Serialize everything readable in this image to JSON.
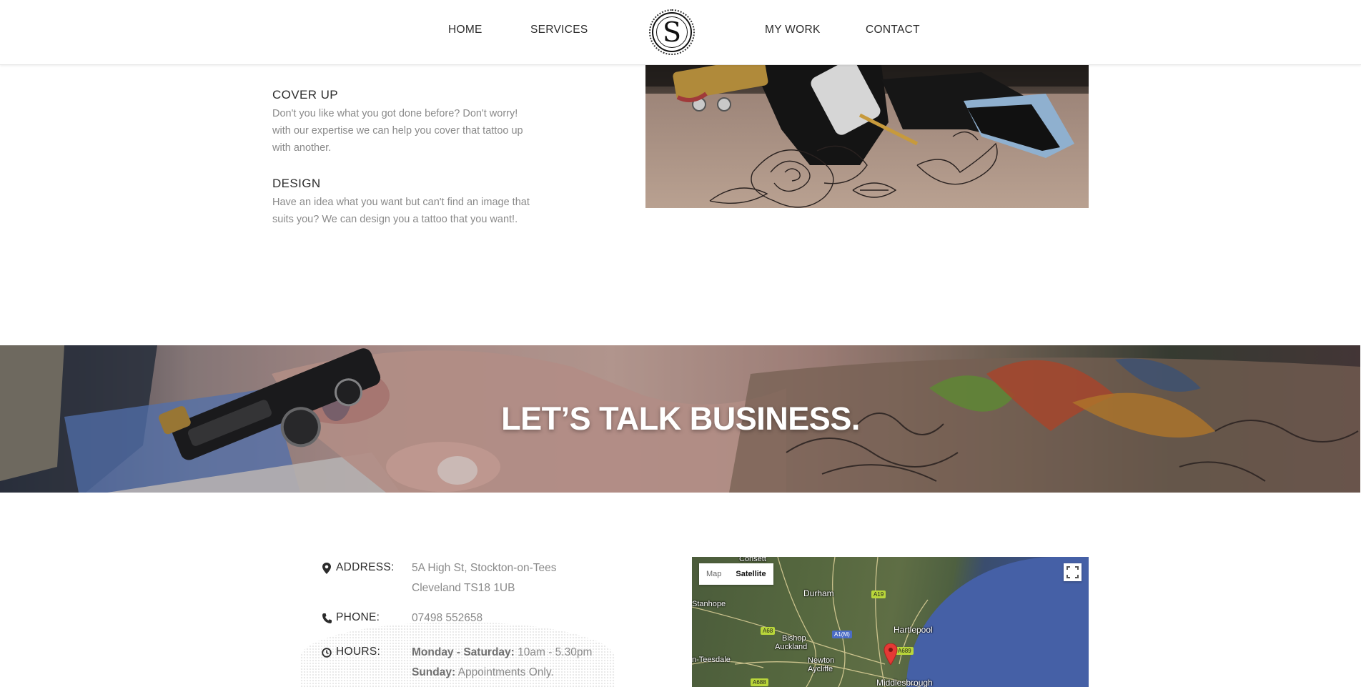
{
  "nav": {
    "home": "HOME",
    "services": "SERVICES",
    "my_work": "MY WORK",
    "contact": "CONTACT",
    "logo_letter": "S"
  },
  "services": [
    {
      "title": "COVER UP",
      "description": "Don't you like what you got done before? Don't worry! with our expertise we can help you cover that tattoo up with another."
    },
    {
      "title": "DESIGN",
      "description": "Have an idea what you want but can't find an image that suits you? We can design you a tattoo that you want!."
    }
  ],
  "banner": {
    "title": "LET’S TALK BUSINESS."
  },
  "contact": {
    "address_label": "ADDRESS:",
    "address_line1": "5A High St, Stockton-on-Tees",
    "address_line2": "Cleveland TS18 1UB",
    "phone_label": "PHONE:",
    "phone_value": "07498 552658",
    "hours_label": "HOURS:",
    "hours_weekday_label": "Monday - Saturday:",
    "hours_weekday_value": " 10am - 5.30pm",
    "hours_sunday_label": "Sunday:",
    "hours_sunday_value": " Appointments Only."
  },
  "map": {
    "map_button": "Map",
    "satellite_button": "Satellite",
    "labels": {
      "consett": "Consett",
      "durham": "Durham",
      "stanhope": "Stanhope",
      "hartlepool": "Hartlepool",
      "bishop_auckland_1": "Bishop",
      "bishop_auckland_2": "Auckland",
      "teesdale": "n-Teesdale",
      "newton_aycliffe_1": "Newton",
      "newton_aycliffe_2": "Aycliffe",
      "middlesbrough": "Middlesbrough"
    },
    "roads": {
      "a19": "A19",
      "a68": "A68",
      "a1m": "A1(M)",
      "a689": "A689",
      "a688": "A688"
    }
  },
  "colors": {
    "accent": "#2b2b2b",
    "muted_text": "#8a8a8a",
    "map_pin": "#e53935"
  }
}
